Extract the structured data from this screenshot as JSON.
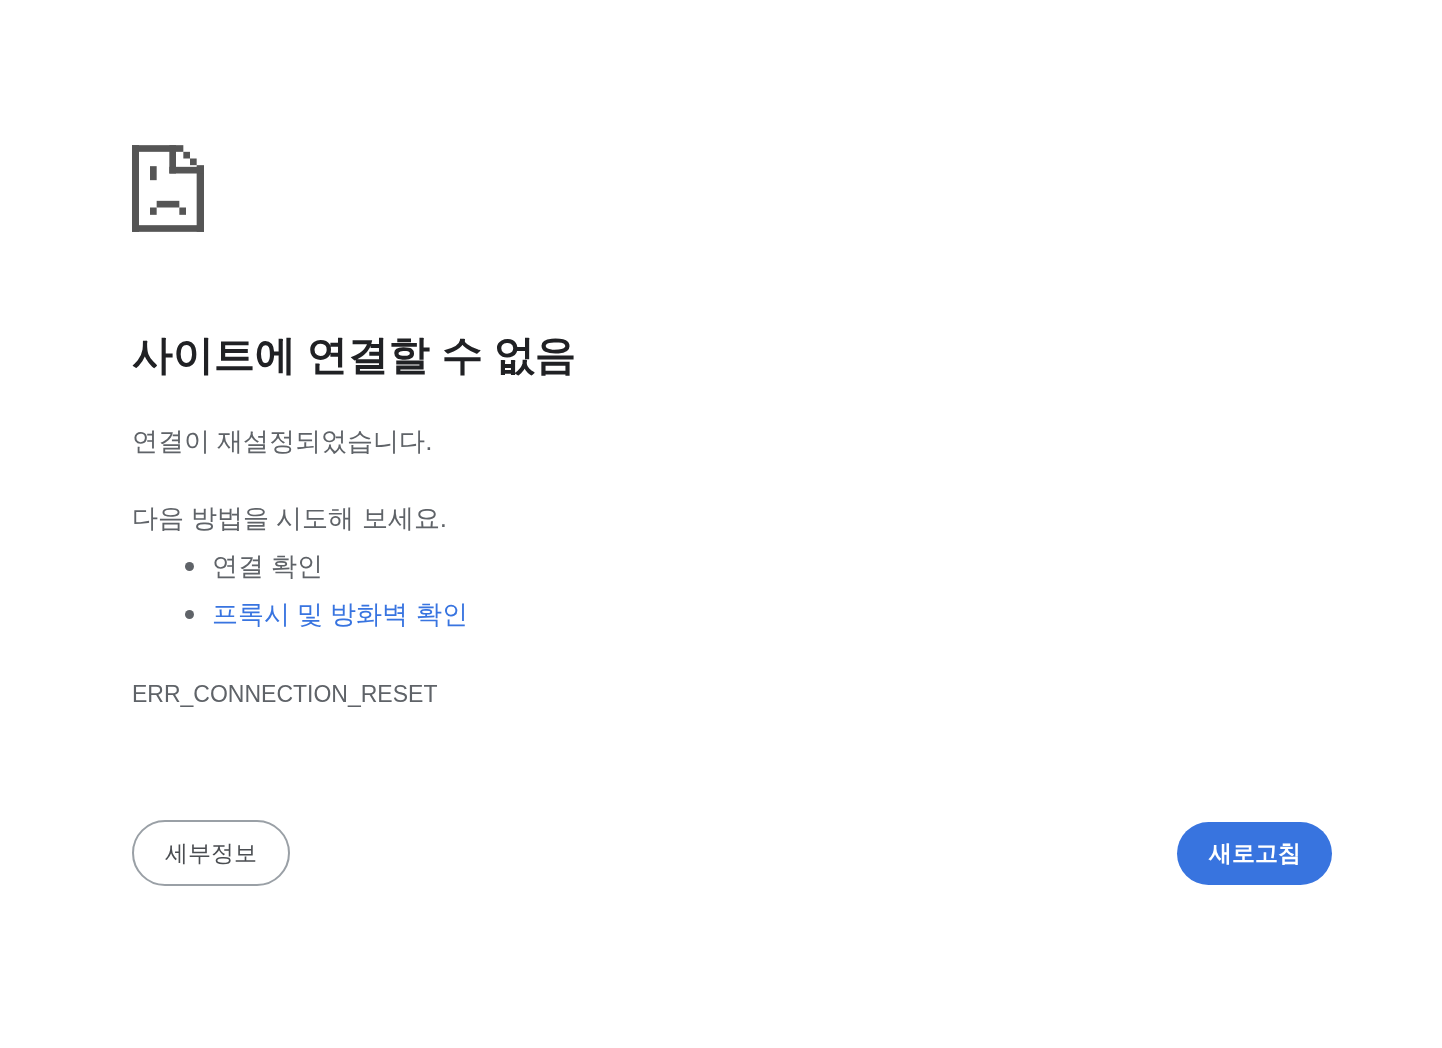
{
  "heading": "사이트에 연결할 수 없음",
  "message": "연결이 재설정되었습니다.",
  "suggestions": {
    "intro": "다음 방법을 시도해 보세요.",
    "items": [
      {
        "text": "연결 확인",
        "kind": "text"
      },
      {
        "text": "프록시 및 방화벽 확인",
        "kind": "link"
      }
    ]
  },
  "error_code": "ERR_CONNECTION_RESET",
  "buttons": [
    {
      "label": "세부정보",
      "kind": "secondary"
    },
    {
      "label": "새로고침",
      "kind": "primary"
    }
  ]
}
